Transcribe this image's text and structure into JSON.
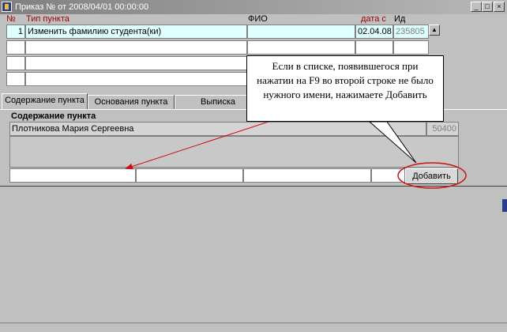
{
  "window": {
    "title": "Приказ № от 2008/04/01 00:00:00",
    "controls": {
      "minimize": "_",
      "maximize": "□",
      "close": "×"
    }
  },
  "table": {
    "headers": {
      "num": "№",
      "type": "Тип пункта",
      "fio": "ФИО",
      "date": "дата с",
      "id": "Ид"
    },
    "rows": [
      {
        "num": "1",
        "type": "Изменить фамилию студента(ки)",
        "fio": "",
        "date": "02.04.08",
        "id": "235805"
      },
      {
        "num": "",
        "type": "",
        "fio": "",
        "date": "",
        "id": ""
      },
      {
        "num": "",
        "type": "",
        "fio": "",
        "date": "",
        "id": ""
      },
      {
        "num": "",
        "type": "",
        "fio": "",
        "date": "",
        "id": ""
      }
    ]
  },
  "tabs": [
    {
      "label": "Содержание пункта",
      "active": true
    },
    {
      "label": "Основания пункта",
      "active": false
    },
    {
      "label": "Выписка",
      "active": false
    }
  ],
  "content": {
    "section_title": "Содержание пункта",
    "name_value": "Плотникова Мария Сергеевна",
    "code_value": "50400",
    "add_button": "Добавить"
  },
  "callout": {
    "text": "Если в списке, появившегося  при нажатии на F9 во второй строке не было нужного имени, нажимаете Добавить"
  },
  "colors": {
    "header_red": "#9a0000",
    "annotation_red": "#d01010",
    "selected_row": "#e0ffff"
  }
}
